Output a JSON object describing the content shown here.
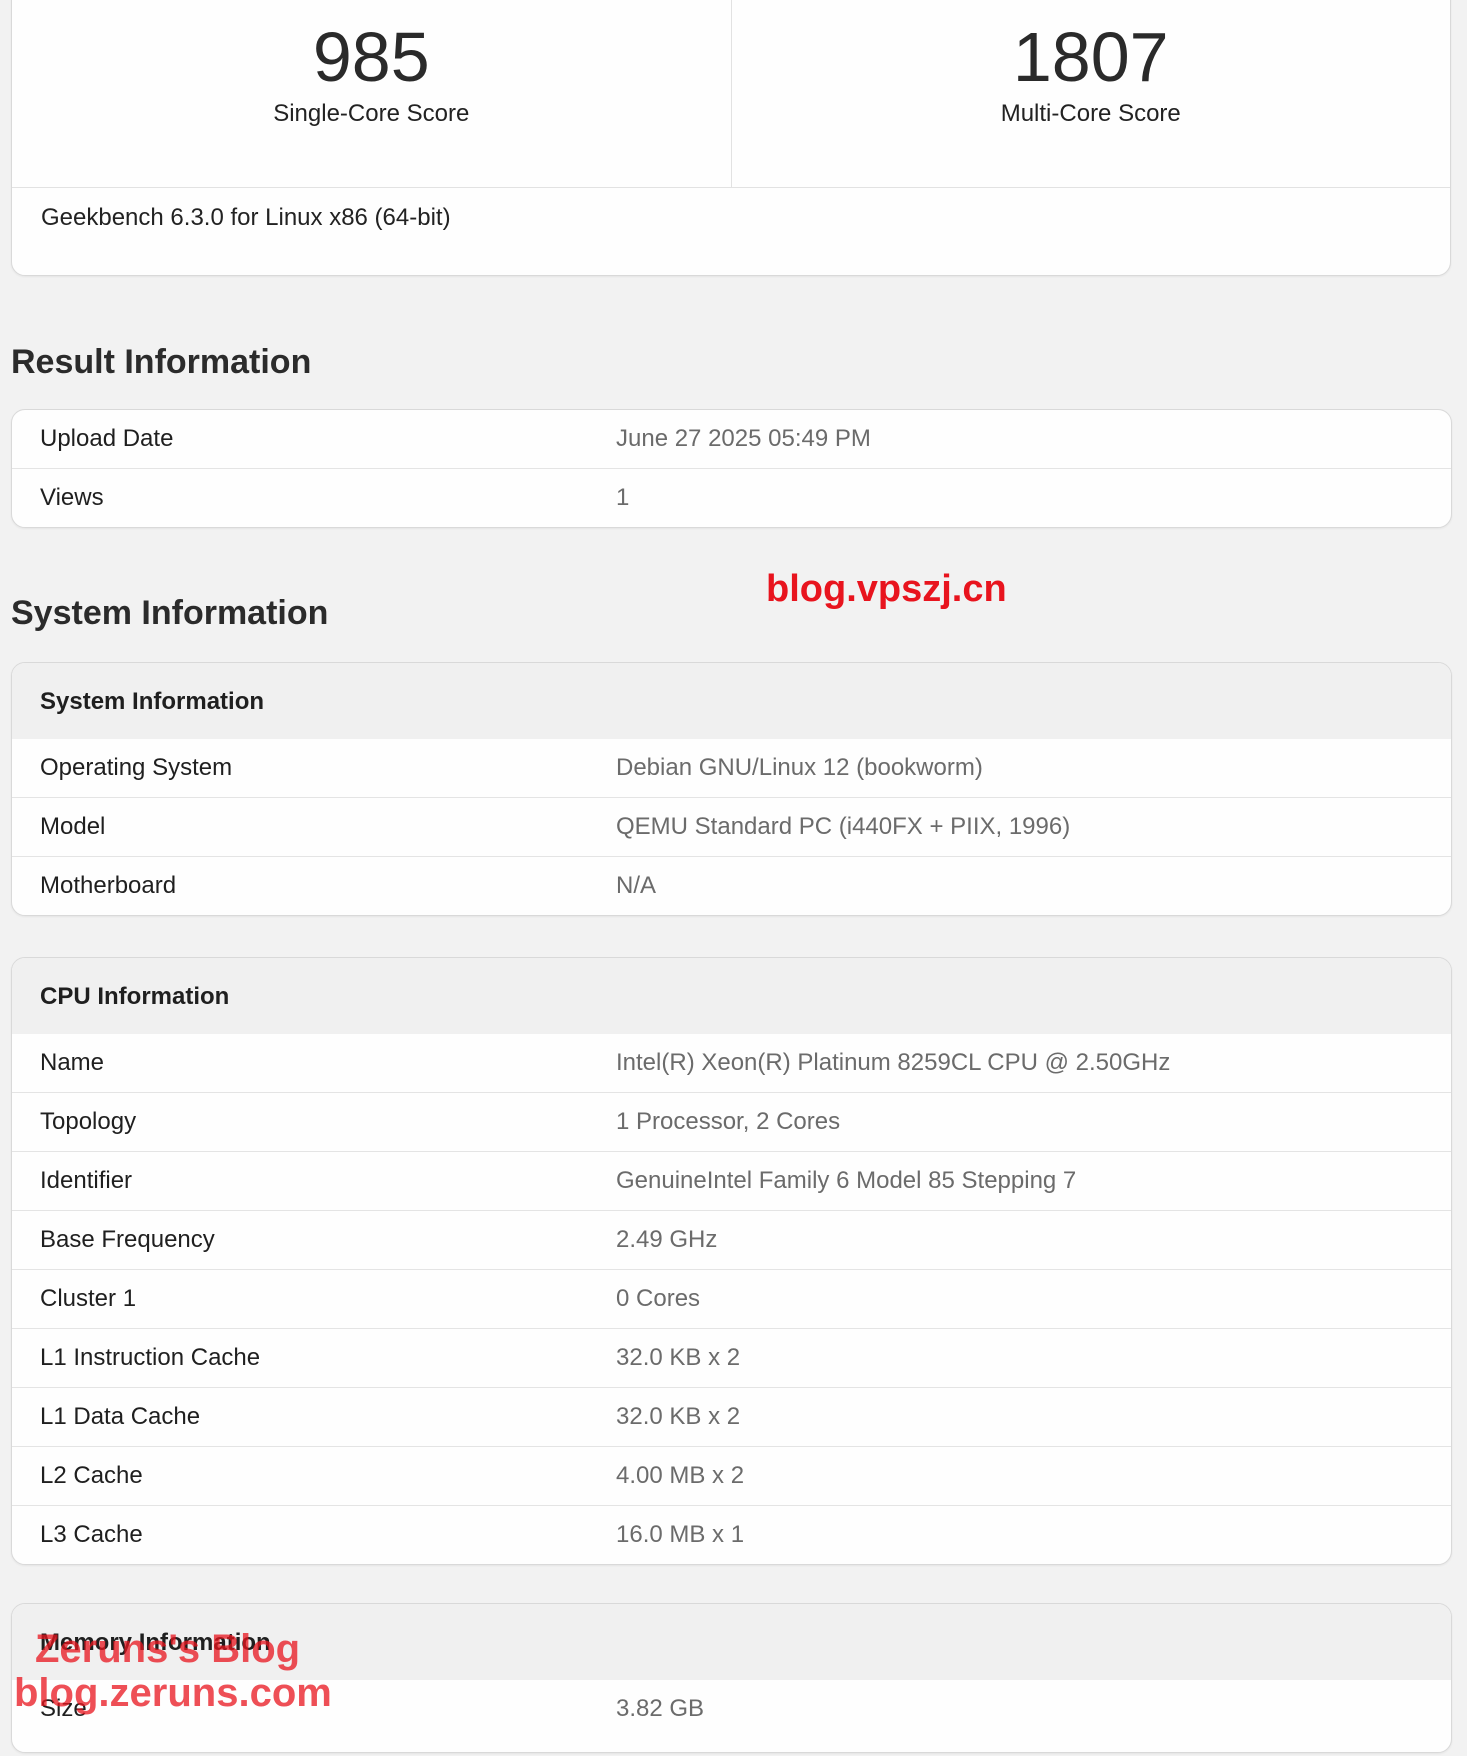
{
  "scores": {
    "single_core": "985",
    "single_core_label": "Single-Core Score",
    "multi_core": "1807",
    "multi_core_label": "Multi-Core Score",
    "version": "Geekbench 6.3.0 for Linux x86 (64-bit)"
  },
  "result_info": {
    "heading": "Result Information",
    "rows": [
      {
        "key": "Upload Date",
        "value": "June 27 2025 05:49 PM"
      },
      {
        "key": "Views",
        "value": "1"
      }
    ]
  },
  "system_section": {
    "heading": "System Information"
  },
  "system_info": {
    "title": "System Information",
    "rows": [
      {
        "key": "Operating System",
        "value": "Debian GNU/Linux 12 (bookworm)"
      },
      {
        "key": "Model",
        "value": "QEMU Standard PC (i440FX + PIIX, 1996)"
      },
      {
        "key": "Motherboard",
        "value": "N/A"
      }
    ]
  },
  "cpu_info": {
    "title": "CPU Information",
    "rows": [
      {
        "key": "Name",
        "value": "Intel(R) Xeon(R) Platinum 8259CL CPU @ 2.50GHz"
      },
      {
        "key": "Topology",
        "value": "1 Processor, 2 Cores"
      },
      {
        "key": "Identifier",
        "value": "GenuineIntel Family 6 Model 85 Stepping 7"
      },
      {
        "key": "Base Frequency",
        "value": "2.49 GHz"
      },
      {
        "key": "Cluster 1",
        "value": "0 Cores"
      },
      {
        "key": "L1 Instruction Cache",
        "value": "32.0 KB x 2"
      },
      {
        "key": "L1 Data Cache",
        "value": "32.0 KB x 2"
      },
      {
        "key": "L2 Cache",
        "value": "4.00 MB x 2"
      },
      {
        "key": "L3 Cache",
        "value": "16.0 MB x 1"
      }
    ]
  },
  "memory_info": {
    "title": "Memory Information",
    "rows": [
      {
        "key": "Size",
        "value": "3.82 GB"
      }
    ]
  },
  "watermarks": {
    "site": "blog.vpszj.cn",
    "blog_name": "Zeruns's Blog",
    "blog_url": "blog.zeruns.com",
    "color": "#e8141e"
  }
}
